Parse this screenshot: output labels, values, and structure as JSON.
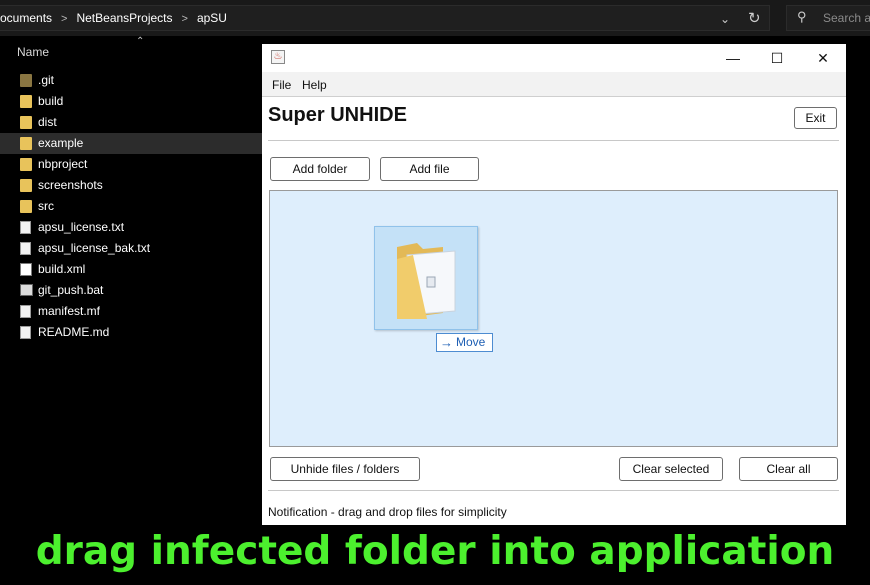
{
  "explorer": {
    "breadcrumbs": [
      "ocuments",
      "NetBeansProjects",
      "apSU"
    ],
    "separator": ">",
    "search_placeholder": "Search ap",
    "column_name": "Name",
    "files": [
      {
        "name": ".git",
        "type": "folder-hidden"
      },
      {
        "name": "build",
        "type": "folder"
      },
      {
        "name": "dist",
        "type": "folder"
      },
      {
        "name": "example",
        "type": "folder",
        "selected": true
      },
      {
        "name": "nbproject",
        "type": "folder"
      },
      {
        "name": "screenshots",
        "type": "folder"
      },
      {
        "name": "src",
        "type": "folder"
      },
      {
        "name": "apsu_license.txt",
        "type": "text"
      },
      {
        "name": "apsu_license_bak.txt",
        "type": "text"
      },
      {
        "name": "build.xml",
        "type": "xml"
      },
      {
        "name": "git_push.bat",
        "type": "batch"
      },
      {
        "name": "manifest.mf",
        "type": "text"
      },
      {
        "name": "README.md",
        "type": "text"
      }
    ]
  },
  "app": {
    "window_controls": {
      "minimize": "—",
      "maximize": "☐",
      "close": "✕"
    },
    "menu": [
      "File",
      "Help"
    ],
    "title": "Super UNHIDE",
    "exit_label": "Exit",
    "add_folder_label": "Add folder",
    "add_file_label": "Add file",
    "drag_tooltip": {
      "arrow": "→",
      "label": "Move"
    },
    "unhide_label": "Unhide files / folders",
    "clear_selected_label": "Clear selected",
    "clear_all_label": "Clear all",
    "notification": "Notification - drag and drop files for simplicity"
  },
  "caption": "drag infected folder into application",
  "colors": {
    "caption": "#4cf02e",
    "drop_zone": "#deeefc",
    "folder": "#e8c35b",
    "explorer_bg": "#000000"
  }
}
